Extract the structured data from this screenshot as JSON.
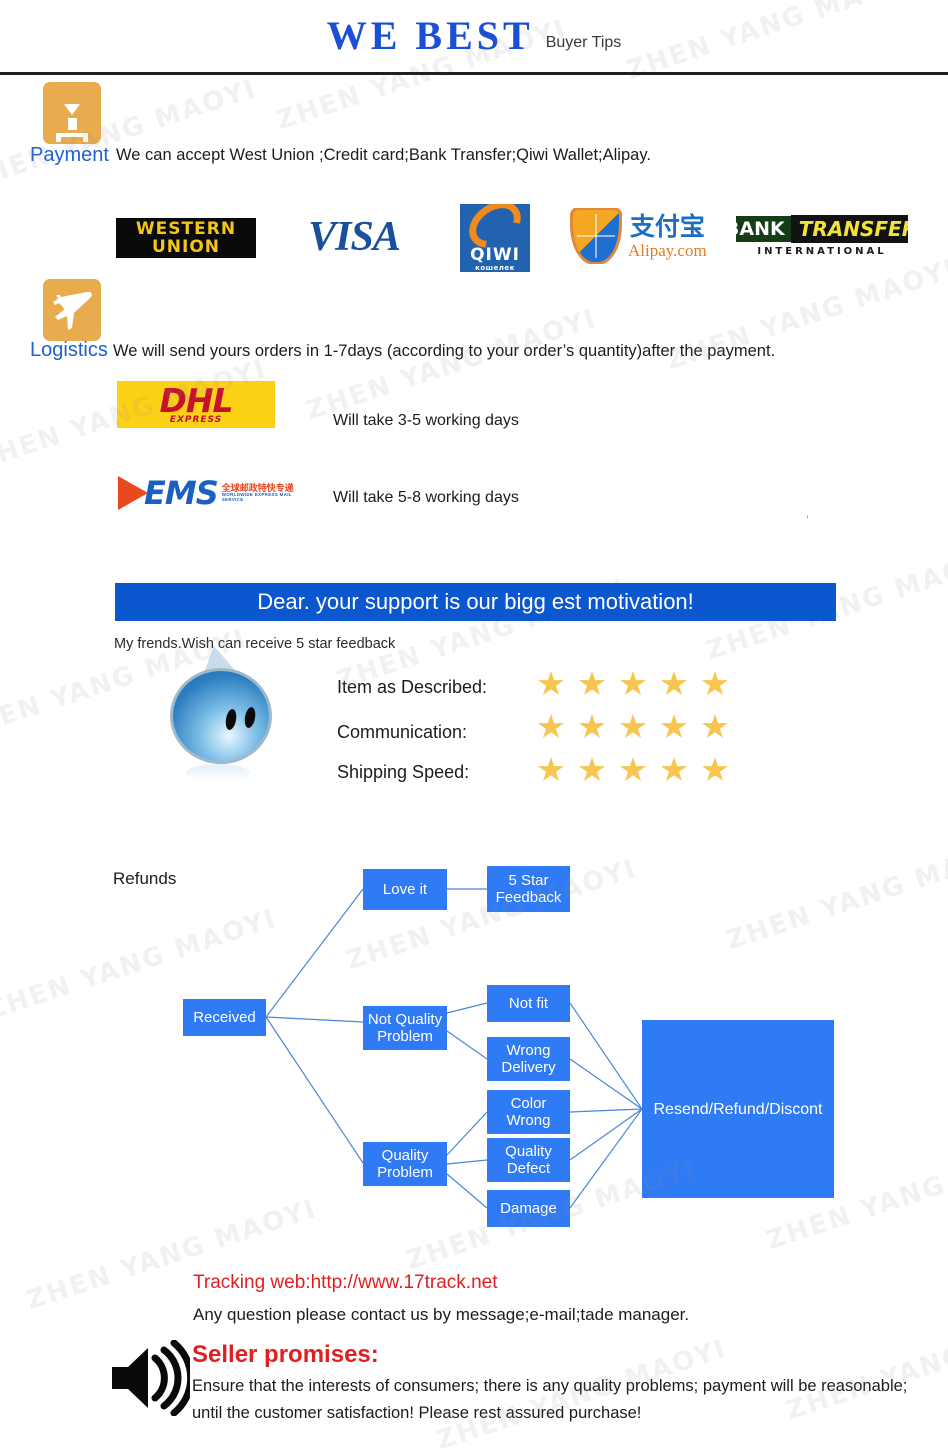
{
  "header": {
    "brand": "WE  BEST",
    "subtitle": "Buyer Tips"
  },
  "watermark": {
    "text": "ZHEN YANG MAOYI"
  },
  "payment": {
    "icon": "package-box-icon",
    "label": "Payment",
    "text": "We can accept West Union ;Credit card;Bank Transfer;Qiwi Wallet;Alipay.",
    "logos": [
      {
        "name": "western-union-logo",
        "line1": "WESTERN",
        "line2": "UNION"
      },
      {
        "name": "visa-logo",
        "text": "VISA"
      },
      {
        "name": "qiwi-logo",
        "text": "QIWI",
        "sub": "кошелек"
      },
      {
        "name": "alipay-logo",
        "cn": "支付宝",
        "en": "Alipay.com"
      },
      {
        "name": "bank-transfer-logo",
        "word1": "BANK",
        "word2": "TRANSFER",
        "sub": "INTERNATIONAL"
      }
    ]
  },
  "logistics": {
    "icon": "airplane-icon",
    "label": "Logistics",
    "text": "We will send yours orders in 1-7days (according to your order’s quantity)after the  payment.",
    "carriers": [
      {
        "name": "dhl-logo",
        "logo": "DHL",
        "logo_sub": "EXPRESS",
        "note": "Will take 3-5 working days"
      },
      {
        "name": "ems-logo",
        "logo": "EMS",
        "logo_cn": "全球邮政特快专递",
        "logo_cn_sub": "WORLDWIDE EXPRESS MAIL SERVICE",
        "note": "Will take 5-8 working days"
      }
    ],
    "stray_mark": ","
  },
  "banner": {
    "text": "Dear. your support is our bigg est motivation!"
  },
  "feedback": {
    "note": "My frends.Wish can receive 5 star feedback",
    "avatar": "blue-smiley-avatar",
    "rows": [
      {
        "label": "Item as Described:",
        "stars": 5
      },
      {
        "label": "Communication:",
        "stars": 5
      },
      {
        "label": "Shipping Speed:",
        "stars": 5
      }
    ]
  },
  "refunds": {
    "title": "Refunds",
    "nodes": {
      "received": "Received",
      "love_it": "Love it",
      "five_star": "5 Star Feedback",
      "not_quality": "Not Quality Problem",
      "quality": "Quality Problem",
      "not_fit": "Not fit",
      "wrong_delivery": "Wrong Delivery",
      "color_wrong": "Color Wrong",
      "quality_defect": "Quality Defect",
      "damage": "Damage",
      "resolution": "Resend/Refund/Discont"
    }
  },
  "footer": {
    "tracking": "Tracking web:http://www.17track.net",
    "contact": "Any question please contact us by message;e-mail;tade manager.",
    "promise_title": "Seller promises:",
    "promise_body": "Ensure that the interests of consumers; there is any quality problems; payment will be reasonable; until the customer satisfaction! Please rest assured purchase!",
    "speaker_icon": "speaker-icon"
  },
  "colors": {
    "brand_blue": "#1a4fd6",
    "icon_amber": "#e8ab4e",
    "banner_blue": "#0b57d0",
    "flow_blue": "#2f7af5",
    "star_gold": "#f8c551",
    "red": "#e02020"
  }
}
